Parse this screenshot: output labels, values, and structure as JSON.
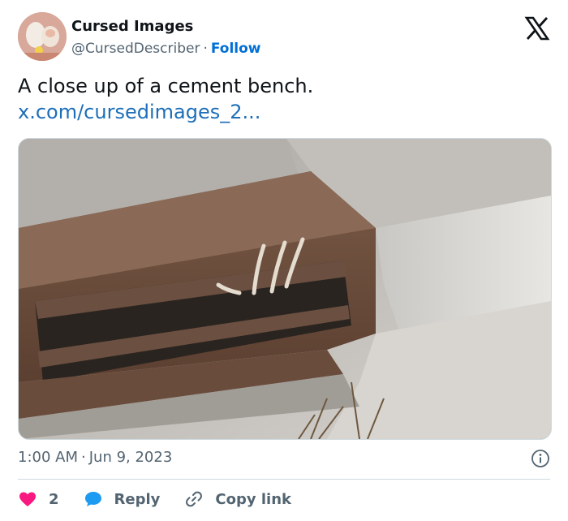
{
  "author": {
    "name": "Cursed Images",
    "handle": "@CursedDescriber",
    "separator": "·",
    "follow_label": "Follow"
  },
  "tweet": {
    "text": "A close up of a cement bench.",
    "link": "x.com/cursedimages_2..."
  },
  "media": {
    "alt_icon": "photo"
  },
  "meta": {
    "time": "1:00 AM",
    "separator": "·",
    "date": "Jun 9, 2023"
  },
  "actions": {
    "like_count": "2",
    "reply_label": "Reply",
    "copy_link_label": "Copy link"
  },
  "colors": {
    "accent": "#006fd6",
    "heart": "#f91880",
    "reply_bubble": "#1d9bf0",
    "muted": "#536471"
  }
}
